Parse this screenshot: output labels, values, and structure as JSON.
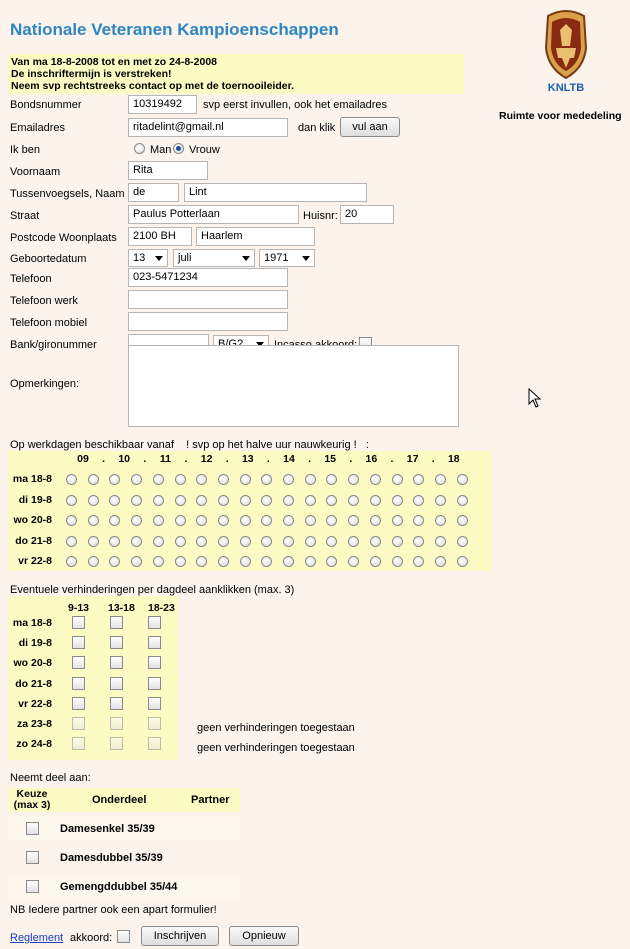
{
  "title": "Nationale Veteranen Kampioenschappen",
  "notice": [
    "Van ma 18-8-2008 tot en met zo 24-8-2008",
    "De inschriftermijn is verstreken!",
    "Neem svp rechtstreeks contact op met de toernooileider."
  ],
  "logo_text": "KNLTB",
  "side_note": "Ruimte voor mededeling",
  "form": {
    "bondsnummer_label": "Bondsnummer",
    "bondsnummer_value": "10319492",
    "bondsnummer_hint": "svp eerst invullen, ook het emailadres",
    "email_label": "Emailadres",
    "email_value": "ritadelint@gmail.nl",
    "email_hint": "dan klik",
    "fill_button": "vul aan",
    "gender_label": "Ik ben",
    "gender_man": "Man",
    "gender_vrouw": "Vrouw",
    "gender_selected": "Vrouw",
    "voornaam_label": "Voornaam",
    "voornaam_value": "Rita",
    "tussen_label": "Tussenvoegsels, Naam",
    "tussen_value": "de",
    "naam_value": "Lint",
    "straat_label": "Straat",
    "straat_value": "Paulus Potterlaan",
    "huisnr_label": "Huisnr:",
    "huisnr_value": "20",
    "postcode_label": "Postcode Woonplaats",
    "postcode_value": "2100 BH",
    "woonplaats_value": "Haarlem",
    "geboorte_label": "Geboortedatum",
    "dag_value": "13",
    "maand_value": "juli",
    "jaar_value": "1971",
    "telefoon_label": "Telefoon",
    "telefoon_value": "023-5471234",
    "telwerk_label": "Telefoon werk",
    "telwerk_value": "",
    "telmobiel_label": "Telefoon mobiel",
    "telmobiel_value": "",
    "bank_label": "Bank/gironummer",
    "bank_value": "",
    "bg_value": "B/G?",
    "incasso_label": "Incasso akkoord:",
    "opm_label": "Opmerkingen:",
    "opm_value": ""
  },
  "availability": {
    "heading": "Op werkdagen beschikbaar vanaf    ! svp op het halve uur nauwkeurig !   :",
    "hours": [
      "09",
      ".",
      "10",
      ".",
      "11",
      ".",
      "12",
      ".",
      "13",
      ".",
      "14",
      ".",
      "15",
      ".",
      "16",
      ".",
      "17",
      ".",
      "18"
    ],
    "days": [
      "ma 18-8",
      "di 19-8",
      "wo 20-8",
      "do 21-8",
      "vr 22-8"
    ]
  },
  "blocks": {
    "heading": "Eventuele verhinderingen per dagdeel aanklikken (max. 3)",
    "columns": [
      "9-13",
      "13-18",
      "18-23"
    ],
    "days": [
      "ma 18-8",
      "di 19-8",
      "wo 20-8",
      "do 21-8",
      "vr 22-8",
      "za 23-8",
      "zo 24-8"
    ],
    "weekend_note": "geen verhinderingen toegestaan"
  },
  "participation": {
    "heading": "Neemt deel aan:",
    "col_keuze": "Keuze (max 3)",
    "col_keuze1": "Keuze",
    "col_keuze2": "(max 3)",
    "col_onderdeel": "Onderdeel",
    "col_partner": "Partner",
    "events": [
      "Damesenkel 35/39",
      "Damesdubbel 35/39",
      "Gemengddubbel 35/44"
    ],
    "note": "NB Iedere partner ook een apart formulier!"
  },
  "footer": {
    "reglement_link": "Reglement",
    "akkoord": "akkoord:",
    "submit": "Inschrijven",
    "reset": "Opnieuw"
  }
}
